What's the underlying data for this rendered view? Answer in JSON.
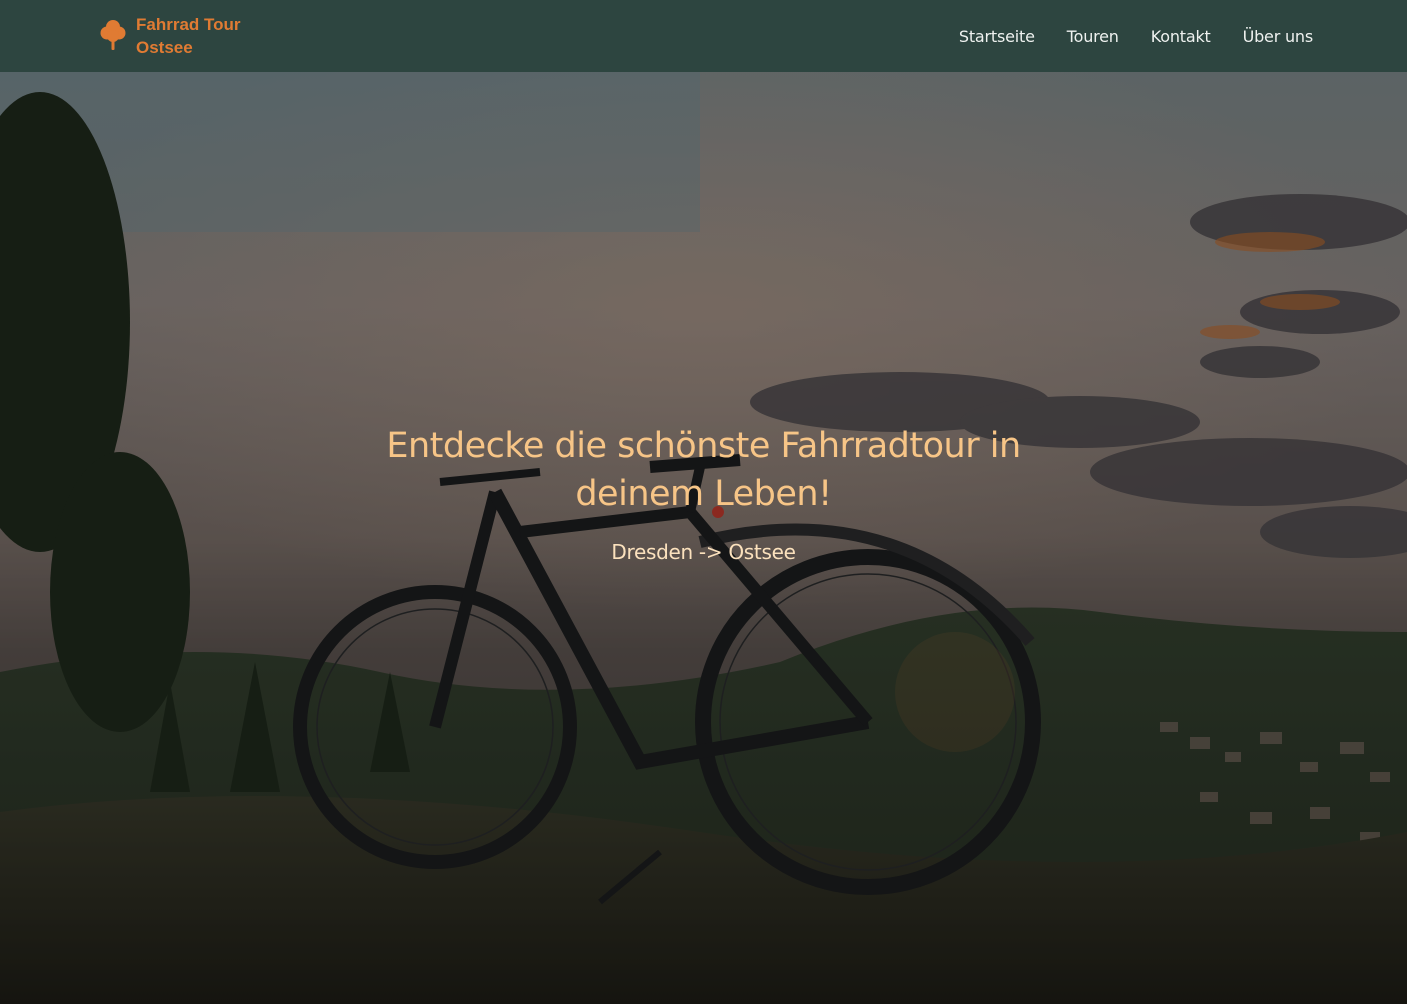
{
  "brand": {
    "line1": "Fahrrad Tour",
    "line2": "Ostsee",
    "icon": "tree-icon",
    "color": "#e07b33"
  },
  "nav": {
    "items": [
      {
        "label": "Startseite"
      },
      {
        "label": "Touren"
      },
      {
        "label": "Kontakt"
      },
      {
        "label": "Über uns"
      }
    ]
  },
  "hero": {
    "title": "Entdecke die schönste Fahrradtour in deinem Leben!",
    "subtitle": "Dresden -> Ostsee",
    "title_color": "#f7c587",
    "background": "photo of an e-bike on a grassy hill at sunset with forest and village"
  },
  "colors": {
    "navbar": "#2d4540",
    "accent": "#e07b33"
  }
}
